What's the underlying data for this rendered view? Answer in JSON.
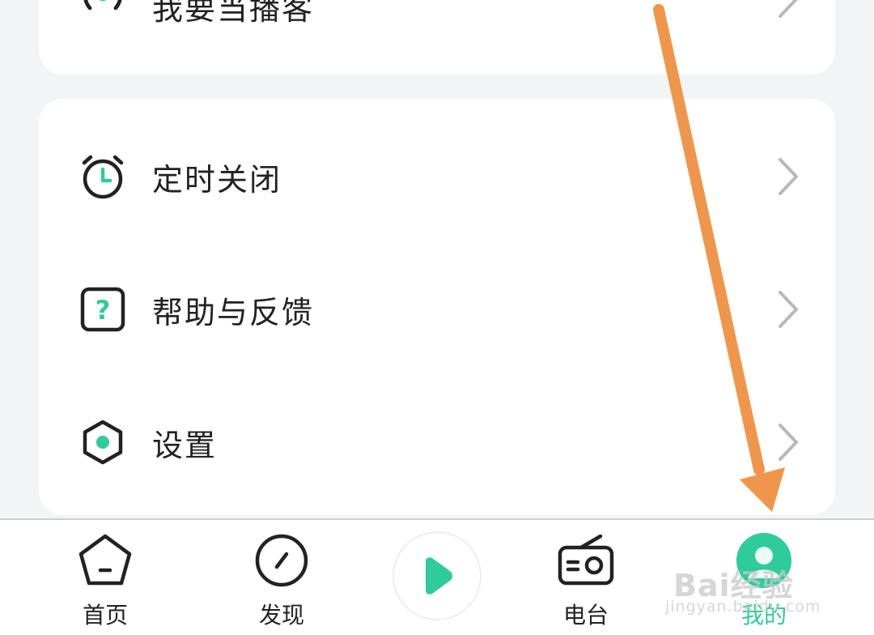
{
  "menu_top": {
    "label": "我要当播客",
    "icon": "broadcast-icon"
  },
  "menu": {
    "items": [
      {
        "label": "定时关闭",
        "icon": "alarm-clock-icon"
      },
      {
        "label": "帮助与反馈",
        "icon": "help-icon"
      },
      {
        "label": "设置",
        "icon": "settings-icon"
      }
    ]
  },
  "tabbar": {
    "tabs": [
      {
        "label": "首页",
        "icon": "home-icon",
        "active": false
      },
      {
        "label": "发现",
        "icon": "discover-icon",
        "active": false
      },
      {
        "label": "",
        "icon": "play-icon",
        "active": false
      },
      {
        "label": "电台",
        "icon": "radio-icon",
        "active": false
      },
      {
        "label": "我的",
        "icon": "profile-icon",
        "active": true
      }
    ]
  },
  "watermark": {
    "brand": "Bai经验",
    "url": "jingyan.baidu.com"
  },
  "colors": {
    "accent": "#2ecc9a",
    "annotation_arrow": "#f0964a",
    "text": "#222222",
    "chevron": "#b8b8b8"
  }
}
